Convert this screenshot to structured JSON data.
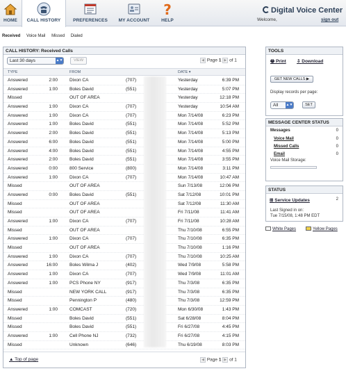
{
  "nav": {
    "tabs": [
      {
        "label": "HOME",
        "icon": "house-icon"
      },
      {
        "label": "CALL HISTORY",
        "icon": "telephone-icon"
      },
      {
        "label": "PREFERENCES",
        "icon": "preferences-panel-icon"
      },
      {
        "label": "MY ACCOUNT",
        "icon": "contact-card-icon"
      },
      {
        "label": "HELP",
        "icon": "question-mark-icon"
      }
    ],
    "active_tab": "CALL HISTORY",
    "brand": "Digital Voice Center",
    "welcome": "Welcome,",
    "signout": "sign out"
  },
  "subnav": [
    "Received",
    "Voice Mail",
    "Missed",
    "Dialed"
  ],
  "panel": {
    "title": "CALL HISTORY: Received Calls",
    "range_select": "Last 30 days",
    "view_button": "VIEW",
    "pager": {
      "page_word": "Page",
      "page": "1",
      "of_word": "of",
      "total": "1"
    },
    "columns": {
      "type": "TYPE",
      "from": "FROM",
      "date": "DATE ▾"
    },
    "top_link": "Top of page"
  },
  "calls": [
    {
      "type": "Answered",
      "duration": "2:00",
      "from": "Dixon CA",
      "area": "(707)",
      "date": "Yesterday",
      "time": "6:39 PM"
    },
    {
      "type": "Answered",
      "duration": "1:00",
      "from": "Boles David",
      "area": "(551)",
      "date": "Yesterday",
      "time": "5:07 PM"
    },
    {
      "type": "Missed",
      "duration": "",
      "from": "OUT OF AREA",
      "area": "",
      "date": "Yesterday",
      "time": "12:18 PM"
    },
    {
      "type": "Answered",
      "duration": "1:00",
      "from": "Dixon CA",
      "area": "(707)",
      "date": "Yesterday",
      "time": "10:54 AM"
    },
    {
      "type": "Answered",
      "duration": "1:00",
      "from": "Dixon CA",
      "area": "(707)",
      "date": "Mon 7/14/08",
      "time": "6:23 PM"
    },
    {
      "type": "Answered",
      "duration": "1:00",
      "from": "Boles David",
      "area": "(551)",
      "date": "Mon 7/14/08",
      "time": "5:52 PM"
    },
    {
      "type": "Answered",
      "duration": "2:00",
      "from": "Boles David",
      "area": "(551)",
      "date": "Mon 7/14/08",
      "time": "5:13 PM"
    },
    {
      "type": "Answered",
      "duration": "6:00",
      "from": "Boles David",
      "area": "(551)",
      "date": "Mon 7/14/08",
      "time": "5:00 PM"
    },
    {
      "type": "Answered",
      "duration": "4:00",
      "from": "Boles David",
      "area": "(551)",
      "date": "Mon 7/14/08",
      "time": "4:55 PM"
    },
    {
      "type": "Answered",
      "duration": "2:00",
      "from": "Boles David",
      "area": "(551)",
      "date": "Mon 7/14/08",
      "time": "3:55 PM"
    },
    {
      "type": "Answered",
      "duration": "0:00",
      "from": "800 Service",
      "area": "(800)",
      "date": "Mon 7/14/08",
      "time": "3:11 PM"
    },
    {
      "type": "Answered",
      "duration": "1:00",
      "from": "Dixon CA",
      "area": "(707)",
      "date": "Mon 7/14/08",
      "time": "10:47 AM"
    },
    {
      "type": "Missed",
      "duration": "",
      "from": "OUT OF AREA",
      "area": "",
      "date": "Sun 7/13/08",
      "time": "12:06 PM"
    },
    {
      "type": "Answered",
      "duration": "0:00",
      "from": "Boles David",
      "area": "(551)",
      "date": "Sat 7/12/08",
      "time": "10:01 PM"
    },
    {
      "type": "Missed",
      "duration": "",
      "from": "OUT OF AREA",
      "area": "",
      "date": "Sat 7/12/08",
      "time": "11:30 AM"
    },
    {
      "type": "Missed",
      "duration": "",
      "from": "OUT OF AREA",
      "area": "",
      "date": "Fri 7/11/08",
      "time": "11:41 AM"
    },
    {
      "type": "Answered",
      "duration": "1:00",
      "from": "Dixon CA",
      "area": "(707)",
      "date": "Fri 7/11/08",
      "time": "10:28 AM"
    },
    {
      "type": "Missed",
      "duration": "",
      "from": "OUT OF AREA",
      "area": "",
      "date": "Thu 7/10/08",
      "time": "6:55 PM"
    },
    {
      "type": "Answered",
      "duration": "1:00",
      "from": "Dixon CA",
      "area": "(707)",
      "date": "Thu 7/10/08",
      "time": "6:35 PM"
    },
    {
      "type": "Missed",
      "duration": "",
      "from": "OUT OF AREA",
      "area": "",
      "date": "Thu 7/10/08",
      "time": "1:16 PM"
    },
    {
      "type": "Answered",
      "duration": "1:00",
      "from": "Dixon CA",
      "area": "(707)",
      "date": "Thu 7/10/08",
      "time": "10:25 AM"
    },
    {
      "type": "Answered",
      "duration": "16:00",
      "from": "Boles Wilma J",
      "area": "(402)",
      "date": "Wed 7/9/08",
      "time": "5:58 PM"
    },
    {
      "type": "Answered",
      "duration": "1:00",
      "from": "Dixon CA",
      "area": "(707)",
      "date": "Wed 7/9/08",
      "time": "11:01 AM"
    },
    {
      "type": "Answered",
      "duration": "1:00",
      "from": "PCS Phone NY",
      "area": "(917)",
      "date": "Thu 7/3/08",
      "time": "6:35 PM"
    },
    {
      "type": "Missed",
      "duration": "",
      "from": "NEW YORK CALL",
      "area": "(917)",
      "date": "Thu 7/3/08",
      "time": "6:35 PM"
    },
    {
      "type": "Missed",
      "duration": "",
      "from": "Pennington P",
      "area": "(480)",
      "date": "Thu 7/3/08",
      "time": "12:59 PM"
    },
    {
      "type": "Answered",
      "duration": "1:00",
      "from": "COMCAST",
      "area": "(720)",
      "date": "Mon 6/30/08",
      "time": "1:43 PM"
    },
    {
      "type": "Missed",
      "duration": "",
      "from": "Boles David",
      "area": "(551)",
      "date": "Sat 6/28/08",
      "time": "8:04 PM"
    },
    {
      "type": "Missed",
      "duration": "",
      "from": "Boles David",
      "area": "(551)",
      "date": "Fri 6/27/08",
      "time": "4:45 PM"
    },
    {
      "type": "Answered",
      "duration": "1:00",
      "from": "Cell Phone NJ",
      "area": "(732)",
      "date": "Fri 6/27/08",
      "time": "4:15 PM"
    },
    {
      "type": "Missed",
      "duration": "",
      "from": "Unknown",
      "area": "(646)",
      "date": "Thu 6/19/08",
      "time": "8:03 PM"
    }
  ],
  "tools": {
    "title": "TOOLS",
    "print": "Print",
    "download": "Download",
    "get_new_calls": "GET NEW CALLS ▶",
    "display_label": "Display records per page:",
    "display_value": "All",
    "set_button": "SET"
  },
  "message_center": {
    "title": "MESSAGE CENTER STATUS",
    "messages_label": "Messages",
    "messages_count": "0",
    "items": [
      {
        "label": "Voice Mail",
        "count": "0"
      },
      {
        "label": "Missed Calls",
        "count": "0"
      },
      {
        "label": "Email",
        "count": "0"
      }
    ],
    "storage_label": "Voice Mail Storage:"
  },
  "status": {
    "title": "STATUS",
    "service_updates": "Service Updates",
    "service_updates_count": "2",
    "last_signed_label": "Last Signed in on:",
    "last_signed_value": "Tue 7/15/08, 1:48 PM EDT"
  },
  "footer_links": {
    "white_pages": "White Pages",
    "yellow_pages": "Yellow Pages"
  }
}
